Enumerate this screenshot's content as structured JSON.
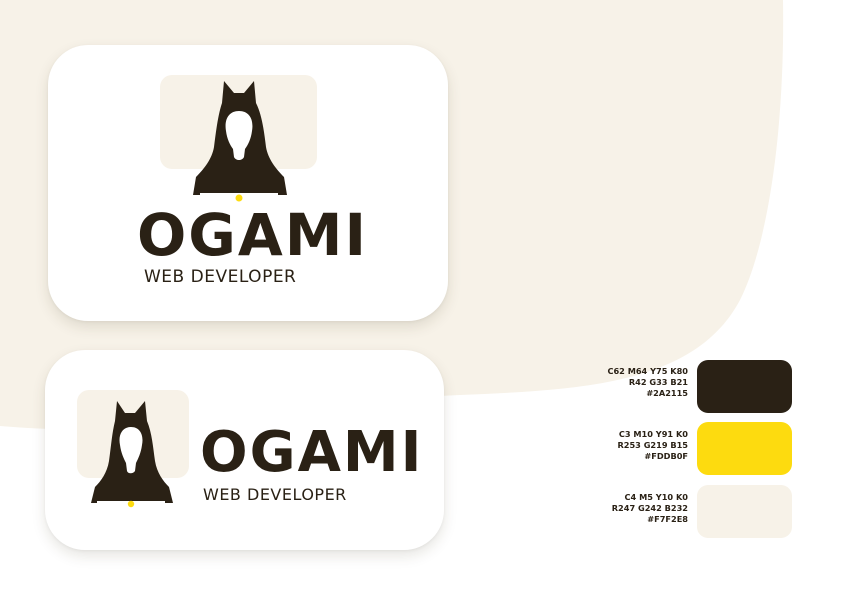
{
  "colors": {
    "background_blob": "#F7F2E8",
    "page": "#FFFFFF",
    "card": "#FFFFFF",
    "dark": "#2A2115",
    "yellow": "#FDDB0F",
    "cream": "#F7F2E8"
  },
  "logo_vertical": {
    "wordmark": "OGAMI",
    "subtitle": "WEB DEVELOPER",
    "icon": "fox-developer-mascot-icon"
  },
  "logo_horizontal": {
    "wordmark": "OGAMI",
    "subtitle": "WEB DEVELOPER",
    "icon": "fox-developer-mascot-icon"
  },
  "palette": [
    {
      "cmyk": "C62 M64 Y75 K80",
      "rgb": "R42 G33 B21",
      "hex": "#2A2115",
      "swatch": "#2A2115"
    },
    {
      "cmyk": "C3 M10 Y91 K0",
      "rgb": "R253 G219 B15",
      "hex": "#FDDB0F",
      "swatch": "#FDDB0F"
    },
    {
      "cmyk": "C4 M5 Y10 K0",
      "rgb": "R247 G242 B232",
      "hex": "#F7F2E8",
      "swatch": "#F7F2E8"
    }
  ]
}
